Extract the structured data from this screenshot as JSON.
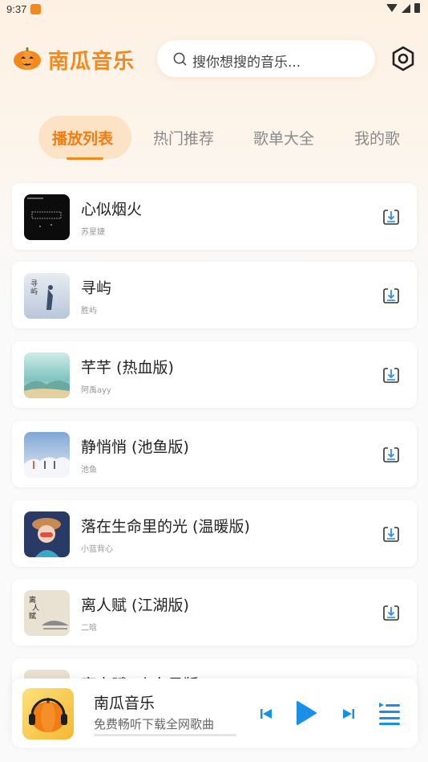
{
  "status_bar": {
    "time": "9:37"
  },
  "header": {
    "logo_icon": "pumpkin-icon",
    "app_name": "南瓜音乐",
    "search_placeholder": "搜你想搜的音乐...",
    "settings_icon": "hexagon-settings-icon"
  },
  "tabs": [
    {
      "label": "播放列表",
      "active": true
    },
    {
      "label": "热门推荐",
      "active": false
    },
    {
      "label": "歌单大全",
      "active": false
    },
    {
      "label": "我的歌",
      "active": false
    }
  ],
  "songs": [
    {
      "title": "心似烟火",
      "artist": "苏星婕"
    },
    {
      "title": "寻屿",
      "artist": "胜屿"
    },
    {
      "title": "芊芊 (热血版)",
      "artist": "阿禹ayy"
    },
    {
      "title": "静悄悄 (池鱼版)",
      "artist": "池鱼"
    },
    {
      "title": "落在生命里的光 (温暖版)",
      "artist": "小蓝背心"
    },
    {
      "title": "离人赋 (江湖版)",
      "artist": "二晗"
    },
    {
      "title": "离人赋 (小东风版)",
      "artist": ""
    }
  ],
  "player": {
    "title": "南瓜音乐",
    "subtitle": "免费畅听下载全网歌曲",
    "progress": 0
  },
  "colors": {
    "accent": "#f5881a",
    "background": "#fafafa"
  }
}
